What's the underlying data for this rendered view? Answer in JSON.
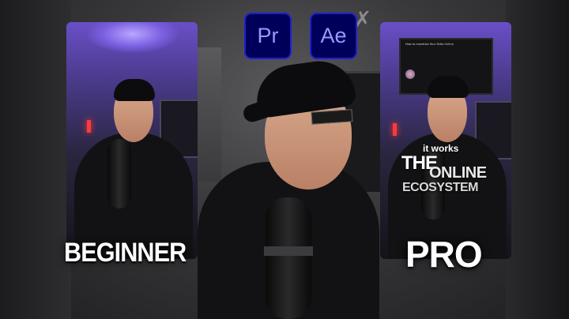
{
  "apps": {
    "premiere_label": "Pr",
    "after_effects_label": "Ae"
  },
  "labels": {
    "left": "BEGINNER",
    "right": "PRO"
  },
  "right_overlay": {
    "line1": "it works",
    "line2": "THE",
    "line3": "ONLINE",
    "line4": "ECOSYSTEM"
  },
  "tv_screen": {
    "title": "How to monetize Your Skills Online"
  },
  "colors": {
    "premiere_bg": "#00005b",
    "premiere_text": "#9999ff",
    "panel_light": "#6a4fc7",
    "neon_red": "#ff3a3a"
  }
}
